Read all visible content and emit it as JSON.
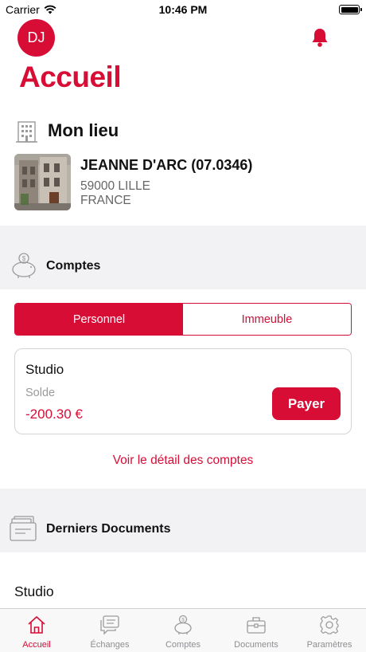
{
  "status_bar": {
    "carrier": "Carrier",
    "time": "10:46 PM"
  },
  "header": {
    "avatar_initials": "DJ",
    "page_title": "Accueil"
  },
  "place": {
    "section_title": "Mon lieu",
    "name": "JEANNE D'ARC (07.0346)",
    "city": "59000 LILLE",
    "country": "FRANCE"
  },
  "accounts": {
    "section_title": "Comptes",
    "tabs": [
      {
        "label": "Personnel",
        "active": true
      },
      {
        "label": "Immeuble",
        "active": false
      }
    ],
    "card": {
      "title": "Studio",
      "balance_label": "Solde",
      "balance_value": "-200.30 €",
      "pay_label": "Payer"
    },
    "detail_link": "Voir le détail des comptes"
  },
  "documents": {
    "section_title": "Derniers Documents",
    "first_item": "Studio"
  },
  "tab_bar": {
    "items": [
      {
        "label": "Accueil",
        "icon": "home-icon",
        "active": true
      },
      {
        "label": "Échanges",
        "icon": "messages-icon",
        "active": false
      },
      {
        "label": "Comptes",
        "icon": "piggy-bank-icon",
        "active": false
      },
      {
        "label": "Documents",
        "icon": "briefcase-icon",
        "active": false
      },
      {
        "label": "Paramètres",
        "icon": "gear-icon",
        "active": false
      }
    ]
  },
  "colors": {
    "accent": "#d70d36",
    "band_background": "#f2f2f4",
    "muted_text": "#666666"
  }
}
